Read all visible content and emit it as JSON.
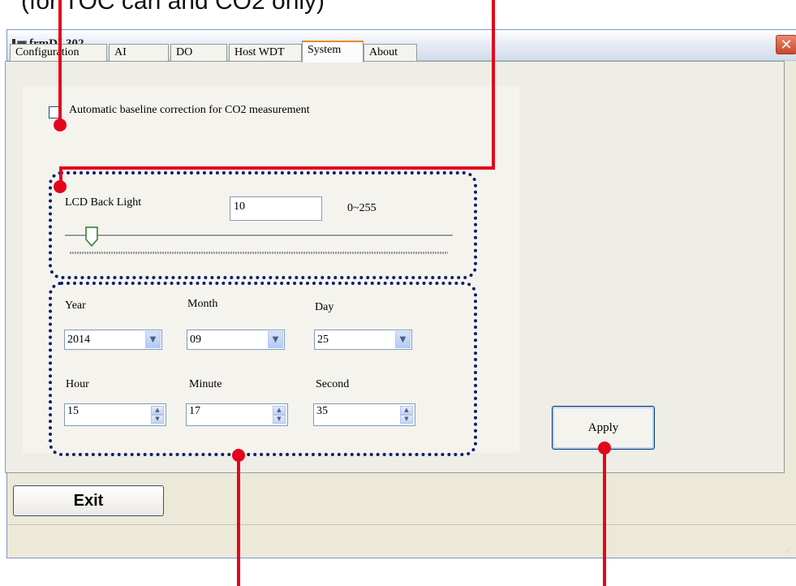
{
  "annotation_top": "(for TOC can and CO2 only)",
  "window": {
    "title": "frmDL302",
    "close_symbol": "✕",
    "icon": "app-icon"
  },
  "tabs": [
    {
      "label": "Configuration",
      "active": false
    },
    {
      "label": "AI",
      "active": false
    },
    {
      "label": "DO",
      "active": false
    },
    {
      "label": "Host WDT",
      "active": false
    },
    {
      "label": "System",
      "active": true
    },
    {
      "label": "About",
      "active": false
    }
  ],
  "system": {
    "baseline_checkbox": {
      "label": "Automatic baseline correction for CO2 measurement",
      "checked": false
    },
    "backlight": {
      "label": "LCD Back Light",
      "value": "10",
      "range_label": "0~255",
      "slider_level": 10,
      "slider_min": 0,
      "slider_max": 255
    },
    "date": {
      "year_label": "Year",
      "year_value": "2014",
      "month_label": "Month",
      "month_value": "09",
      "day_label": "Day",
      "day_value": "25"
    },
    "time": {
      "hour_label": "Hour",
      "hour_value": "15",
      "minute_label": "Minute",
      "minute_value": "17",
      "second_label": "Second",
      "second_value": "35"
    },
    "apply_label": "Apply"
  },
  "exit_label": "Exit",
  "colors": {
    "callout": "#e4051c",
    "dotted_outline": "#0e1d6a",
    "active_tab_accent": "#e68b2c"
  }
}
